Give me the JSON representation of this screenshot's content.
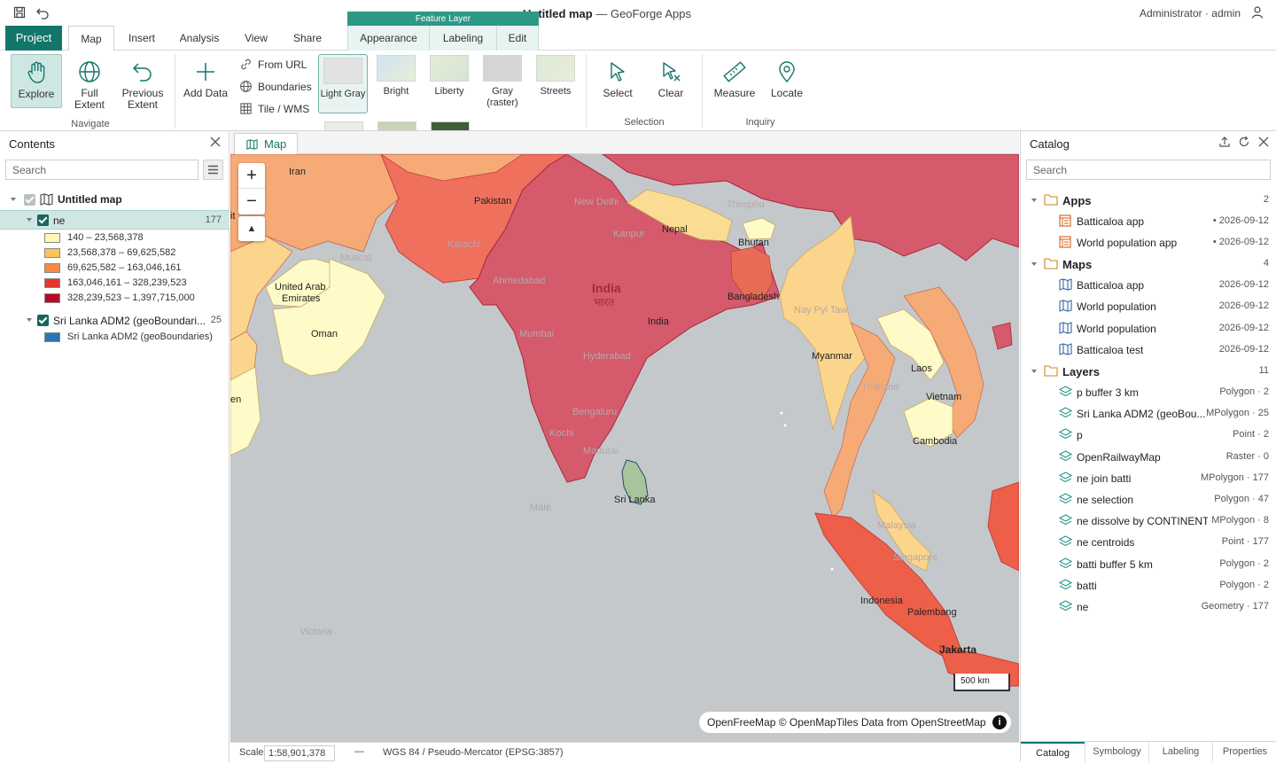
{
  "window": {
    "title_bold": "Untitled map",
    "title_app": " — GeoForge Apps",
    "user": "Administrator · admin",
    "context_tab_group": "Feature Layer"
  },
  "tabs": [
    {
      "label": "Project"
    },
    {
      "label": "Map"
    },
    {
      "label": "Insert"
    },
    {
      "label": "Analysis"
    },
    {
      "label": "View"
    },
    {
      "label": "Share"
    },
    {
      "label": "Appearance"
    },
    {
      "label": "Labeling"
    },
    {
      "label": "Edit"
    }
  ],
  "ribbon": {
    "navigate": {
      "explore": "Explore",
      "full_extent": "Full Extent",
      "previous_extent": "Previous Extent",
      "group": "Navigate"
    },
    "add_data": "Add Data",
    "from_url": "From URL",
    "boundaries": "Boundaries",
    "tile_wms": "Tile / WMS",
    "basemaps": [
      {
        "label": "Light Gray",
        "color": "#e2e2e2"
      },
      {
        "label": "Bright",
        "color": "#cfe0ee"
      },
      {
        "label": "Liberty",
        "color": "#dbe6d2"
      },
      {
        "label": "Gray (raster)",
        "color": "#d4d4d4"
      },
      {
        "label": "Streets",
        "color": "#dae6d6"
      }
    ],
    "selection": {
      "select": "Select",
      "clear": "Clear",
      "group": "Selection"
    },
    "inquiry": {
      "measure": "Measure",
      "locate": "Locate",
      "group": "Inquiry"
    }
  },
  "contents": {
    "title": "Contents",
    "search_placeholder": "Search",
    "map_name": "Untitled map",
    "layer1": {
      "name": "ne",
      "count": "177"
    },
    "legend": [
      {
        "label": "140 – 23,568,378",
        "color": "#fef7b7"
      },
      {
        "label": "23,568,378 – 69,625,582",
        "color": "#fbc45a"
      },
      {
        "label": "69,625,582 – 163,046,161",
        "color": "#f78a45"
      },
      {
        "label": "163,046,161 – 328,239,523",
        "color": "#e5352a"
      },
      {
        "label": "328,239,523 – 1,397,715,000",
        "color": "#bd0726"
      }
    ],
    "layer2": {
      "name": "Sri Lanka ADM2 (geoBoundari...",
      "count": "25",
      "legend_label": "Sri Lanka ADM2 (geoBoundaries)",
      "legend_color": "#2676b8"
    }
  },
  "map": {
    "tab_label": "Map",
    "zoom_in": "+",
    "zoom_out": "−",
    "compass": "▲",
    "scale_label": "500 km",
    "attribution_prefix": "OpenFreeMap © OpenMapTiles",
    "attribution_mid": " Data from ",
    "attribution_osm": "OpenStreetMap",
    "info": "i",
    "labels": {
      "iran": "Iran",
      "pakistan": "Pakistan",
      "india": "India",
      "nepal": "Nepal",
      "bhutan": "Bhutan",
      "bangladesh": "Bangladesh",
      "uae1": "United Arab",
      "uae2": "Emirates",
      "oman": "Oman",
      "myanmar": "Myanmar",
      "laos": "Laos",
      "vietnam": "Vietnam",
      "cambodia": "Cambodia",
      "srilanka": "Sri Lanka",
      "indonesia": "Indonesia",
      "palembang": "Palembang",
      "jakarta": "Jakarta",
      "male": "Malé",
      "victoria": "Victoria",
      "it": "it",
      "en": "en",
      "new_delhi": "New Delhi",
      "india_big": "India",
      "bharat": "भारत",
      "muscat": "Muscat",
      "thailand": "Thailand",
      "malaysia": "Malaysia",
      "singapore": "Singapore",
      "nay_pyi_taw": "Nay Pyi Taw",
      "ahmedabad": "Ahmedabad",
      "mumbai": "Mumbai",
      "hyderabad": "Hyderabad",
      "bengaluru": "Bengaluru",
      "kochi": "Kochi",
      "madurai": "Madurai",
      "karachi": "Karachi",
      "kanpur": "Kanpur",
      "thimphu": "Thimphu"
    }
  },
  "status": {
    "scale_label": "Scale",
    "scale_value": "1:58,901,378",
    "dash": "—",
    "crs": "WGS 84 / Pseudo-Mercator (EPSG:3857)"
  },
  "catalog": {
    "title": "Catalog",
    "search_placeholder": "Search",
    "apps": {
      "label": "Apps",
      "count": "2",
      "items": [
        {
          "name": "Batticaloa app",
          "meta": "• 2026-09-12"
        },
        {
          "name": "World population app",
          "meta": "• 2026-09-12"
        }
      ]
    },
    "maps": {
      "label": "Maps",
      "count": "4",
      "items": [
        {
          "name": "Batticaloa app",
          "meta": "2026-09-12"
        },
        {
          "name": "World population",
          "meta": "2026-09-12"
        },
        {
          "name": "World population",
          "meta": "2026-09-12"
        },
        {
          "name": "Batticaloa test",
          "meta": "2026-09-12"
        }
      ]
    },
    "layers": {
      "label": "Layers",
      "count": "11",
      "items": [
        {
          "name": "p buffer 3 km",
          "meta": "Polygon · 2"
        },
        {
          "name": "Sri Lanka ADM2 (geoBou...",
          "meta": "MPolygon · 25"
        },
        {
          "name": "p",
          "meta": "Point · 2"
        },
        {
          "name": "OpenRailwayMap",
          "meta": "Raster · 0"
        },
        {
          "name": "ne join batti",
          "meta": "MPolygon · 177"
        },
        {
          "name": "ne selection",
          "meta": "Polygon · 47"
        },
        {
          "name": "ne dissolve by CONTINENT",
          "meta": "MPolygon · 8"
        },
        {
          "name": "ne centroids",
          "meta": "Point · 177"
        },
        {
          "name": "batti buffer 5 km",
          "meta": "Polygon · 2"
        },
        {
          "name": "batti",
          "meta": "Polygon · 2"
        },
        {
          "name": "ne",
          "meta": "Geometry · 177"
        }
      ]
    },
    "bottom_tabs": [
      "Catalog",
      "Symbology",
      "Labeling",
      "Properties"
    ]
  },
  "colors": {
    "accent": "#13766a",
    "context_tab": "#2e9887",
    "water": "#c4c8cb"
  }
}
